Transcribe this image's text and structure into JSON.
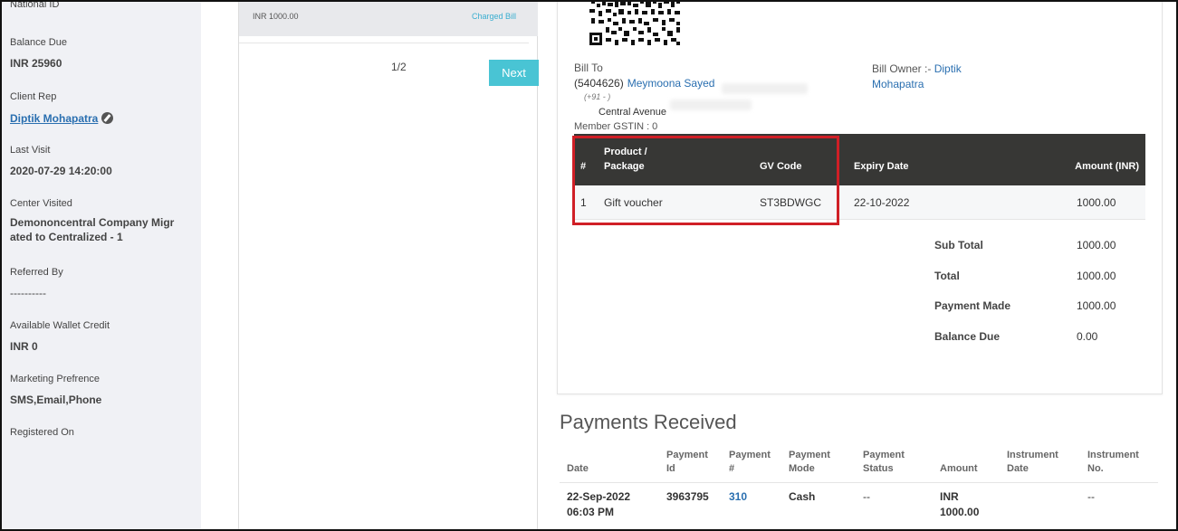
{
  "sidebar": {
    "national_id_label": "National ID",
    "balance_due_label": "Balance Due",
    "balance_due_value": "INR 25960",
    "client_rep_label": "Client Rep",
    "client_rep_value": "Diptik Mohapatra",
    "last_visit_label": "Last Visit",
    "last_visit_value": "2020-07-29 14:20:00",
    "center_visited_label": "Center Visited",
    "center_visited_value": "Demononcentral Company Migrated to Centralized - 1",
    "referred_by_label": "Referred By",
    "referred_by_value": "----------",
    "wallet_label": "Available Wallet Credit",
    "wallet_value": "INR 0",
    "marketing_label": "Marketing Prefrence",
    "marketing_value": "SMS,Email,Phone",
    "registered_label": "Registered On"
  },
  "bill_list": {
    "amount": "INR 1000.00",
    "status": "Charged Bill",
    "page": "1/2",
    "next_label": "Next"
  },
  "invoice": {
    "bill_to_label": "Bill To",
    "client_id": "(5404626)",
    "client_name": "Meymoona Sayed",
    "phone": "(+91 -                    )",
    "address": "Central Avenue",
    "gstin": "Member GSTIN : 0",
    "bill_owner_label": "Bill Owner :-",
    "bill_owner_first": "Diptik",
    "bill_owner_last": "Mohapatra",
    "columns": {
      "num": "#",
      "product_line1": "Product /",
      "product_line2": "Package",
      "gv_code": "GV Code",
      "expiry": "Expiry Date",
      "amount": "Amount (INR)"
    },
    "row": {
      "num": "1",
      "product": "Gift voucher",
      "gv_code": "ST3BDWGC",
      "expiry": "22-10-2022",
      "amount": "1000.00"
    },
    "summary": {
      "sub_total_label": "Sub Total",
      "sub_total_value": "1000.00",
      "total_label": "Total",
      "total_value": "1000.00",
      "payment_made_label": "Payment Made",
      "payment_made_value": "1000.00",
      "balance_due_label": "Balance Due",
      "balance_due_value": "0.00"
    }
  },
  "payments": {
    "title": "Payments Received",
    "headers": {
      "date": "Date",
      "payment_id_1": "Payment",
      "payment_id_2": "Id",
      "payment_num_1": "Payment",
      "payment_num_2": "#",
      "payment_mode_1": "Payment",
      "payment_mode_2": "Mode",
      "payment_status_1": "Payment",
      "payment_status_2": "Status",
      "amount": "Amount",
      "instrument_date_1": "Instrument",
      "instrument_date_2": "Date",
      "instrument_no_1": "Instrument",
      "instrument_no_2": "No."
    },
    "row": {
      "date_1": "22-Sep-2022",
      "date_2": "06:03 PM",
      "payment_id": "3963795",
      "payment_num": "310",
      "mode": "Cash",
      "status": "--",
      "amount_1": "INR",
      "amount_2": "1000.00",
      "instrument_date": "",
      "instrument_no": "--"
    }
  },
  "colors": {
    "accent": "#49c4d4",
    "link": "#2a6fb0",
    "highlight": "#d01f26",
    "table_header": "#373735"
  }
}
